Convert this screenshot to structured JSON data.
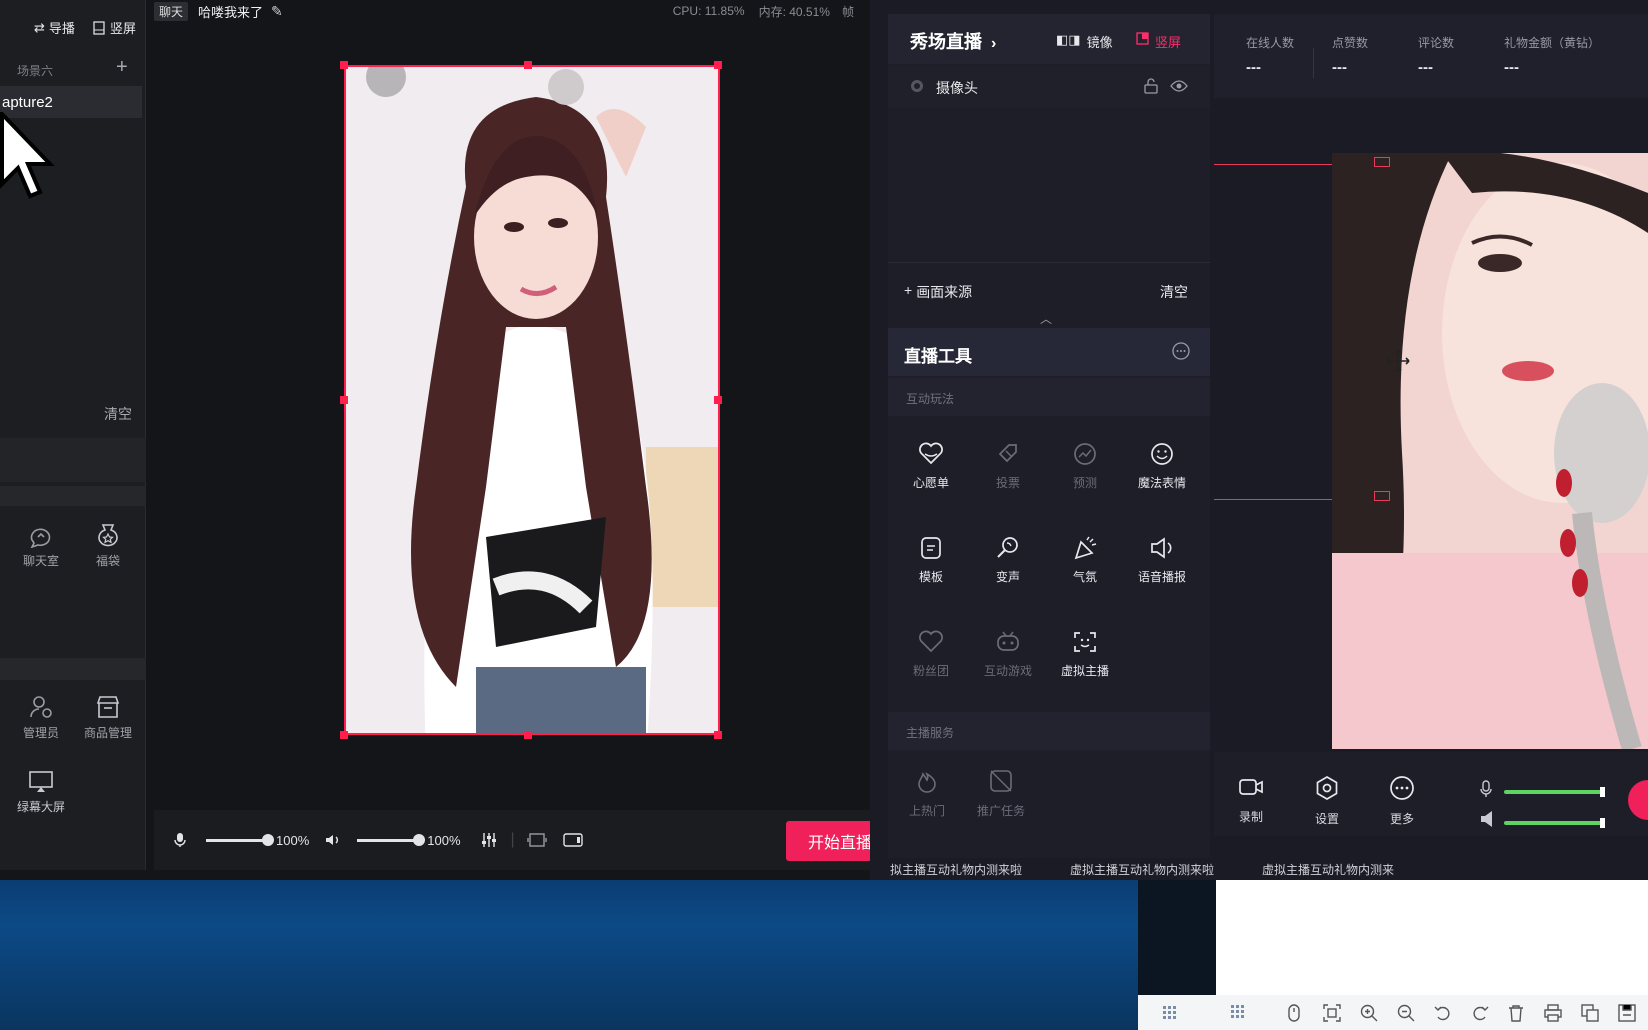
{
  "left_app": {
    "top_buttons": {
      "guide": "导播",
      "portrait": "竖屏"
    },
    "scene_header": "场景六",
    "scene_item": "apture2",
    "clear_label": "清空",
    "sidebar_tools": [
      "聊天室",
      "福袋",
      "管理员",
      "商品管理",
      "绿幕大屏"
    ],
    "chat_tag": "聊天",
    "room_title": "哈喽我来了",
    "cpu": "CPU: 11.85%",
    "memory": "内存: 40.51%",
    "frame_cut": "帧",
    "mic_volume": "100%",
    "speaker_volume": "100%",
    "start_live": "开始直播"
  },
  "live_panel": {
    "title": "秀场直播",
    "mirror": "镜像",
    "portrait": "竖屏",
    "source_camera": "摄像头",
    "add_source": "画面来源",
    "clear": "清空",
    "tools_title": "直播工具",
    "section_interactive": "互动玩法",
    "section_services": "主播服务",
    "tools": [
      {
        "label": "心愿单",
        "icon": "wish-heart-icon",
        "enabled": true
      },
      {
        "label": "投票",
        "icon": "vote-tag-icon",
        "enabled": false
      },
      {
        "label": "预测",
        "icon": "predict-icon",
        "enabled": false
      },
      {
        "label": "魔法表情",
        "icon": "smile-icon",
        "enabled": true
      },
      {
        "label": "模板",
        "icon": "template-icon",
        "enabled": true
      },
      {
        "label": "变声",
        "icon": "microphone-icon",
        "enabled": true
      },
      {
        "label": "气氛",
        "icon": "party-popper-icon",
        "enabled": true
      },
      {
        "label": "语音播报",
        "icon": "speaker-icon",
        "enabled": true
      },
      {
        "label": "粉丝团",
        "icon": "fan-heart-icon",
        "enabled": false
      },
      {
        "label": "互动游戏",
        "icon": "gamepad-icon",
        "enabled": false
      },
      {
        "label": "虚拟主播",
        "icon": "face-scan-icon",
        "enabled": true
      },
      {
        "label": "上热门",
        "icon": "hot-icon",
        "enabled": false
      },
      {
        "label": "推广任务",
        "icon": "promo-icon",
        "enabled": false
      }
    ]
  },
  "stats": [
    {
      "label": "在线人数",
      "value": "---"
    },
    {
      "label": "点赞数",
      "value": "---"
    },
    {
      "label": "评论数",
      "value": "---"
    },
    {
      "label": "礼物金额（黄钻）",
      "value": "---"
    }
  ],
  "right_bottom": {
    "record": "录制",
    "settings": "设置",
    "more": "更多"
  },
  "ticker": [
    "拟主播互动礼物内测来啦",
    "虚拟主播互动礼物内测来啦",
    "虚拟主播互动礼物内测来"
  ],
  "colors": {
    "accent": "#f0205a",
    "selection": "#ff1e4c",
    "level": "#5fd35f"
  }
}
